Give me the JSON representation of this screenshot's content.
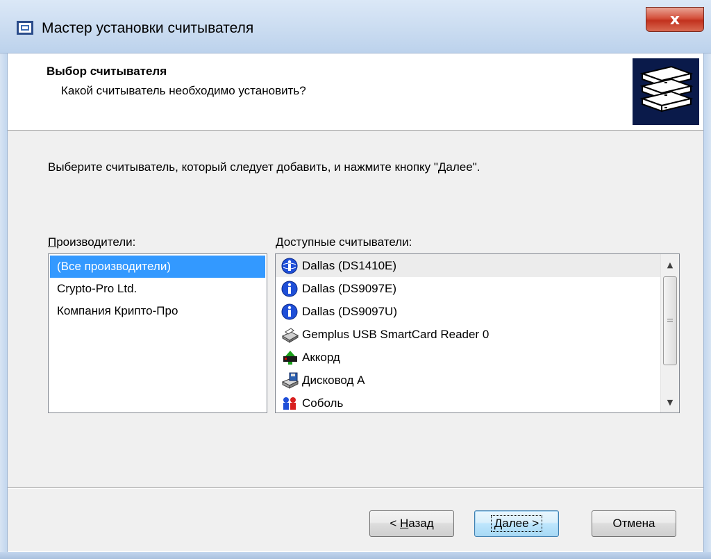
{
  "window": {
    "title": "Мастер установки считывателя",
    "close_label": "x",
    "icon": "reader-app-icon"
  },
  "header": {
    "title": "Выбор считывателя",
    "subtitle": "Какой считыватель необходимо установить?",
    "icon": "reader-stack-icon"
  },
  "content": {
    "instruction": "Выберите считыватель, который следует добавить, и нажмите кнопку \"Далее\".",
    "manufacturers_label_first": "П",
    "manufacturers_label_rest": "роизводители:",
    "readers_label_first": "Д",
    "readers_label_rest": "оступные считыватели:",
    "manufacturers": [
      {
        "label": "(Все производители)",
        "selected": true
      },
      {
        "label": "Crypto-Pro Ltd.",
        "selected": false
      },
      {
        "label": "Компания Крипто-Про",
        "selected": false
      }
    ],
    "readers": [
      {
        "label": "Dallas (DS1410E)",
        "icon": "info-globe-icon"
      },
      {
        "label": "Dallas (DS9097E)",
        "icon": "info-icon"
      },
      {
        "label": "Dallas (DS9097U)",
        "icon": "info-icon"
      },
      {
        "label": "Gemplus USB SmartCard Reader 0",
        "icon": "smartcard-reader-icon"
      },
      {
        "label": "Аккорд",
        "icon": "accord-board-icon"
      },
      {
        "label": "Дисковод А",
        "icon": "floppy-drive-icon"
      },
      {
        "label": "Соболь",
        "icon": "sobol-board-icon"
      }
    ]
  },
  "buttons": {
    "back_prefix": "< ",
    "back_label": "Назад",
    "next_label": "Далее >",
    "cancel_label": "Отмена"
  },
  "colors": {
    "selection": "#3399ff",
    "dialog_bg": "#f0f0f0",
    "titlebar": "#c9dbf0",
    "close_button": "#c2321e"
  }
}
